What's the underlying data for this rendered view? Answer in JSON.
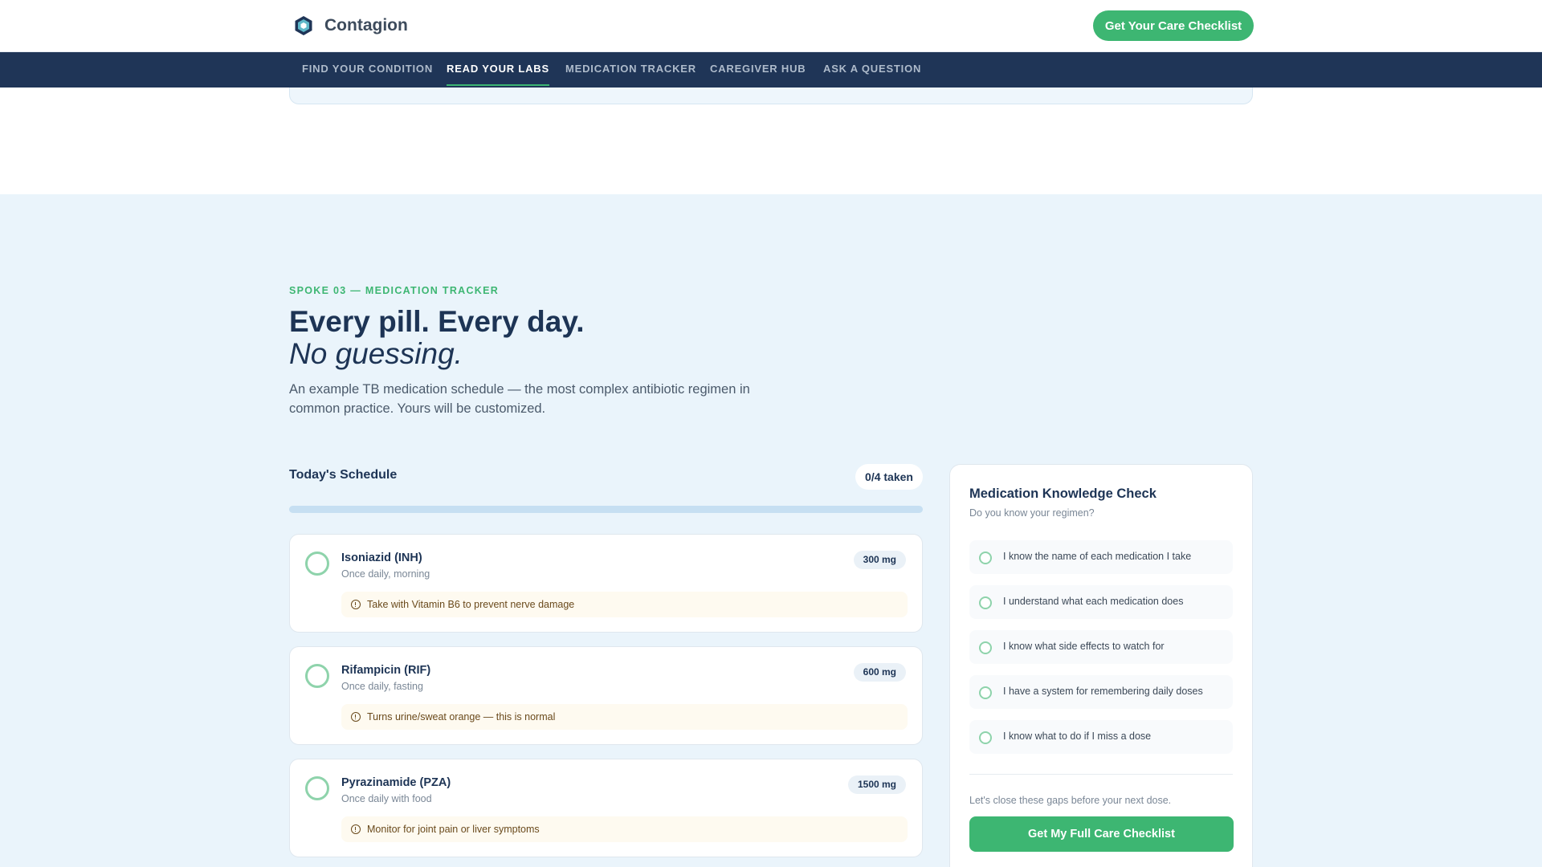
{
  "brand": {
    "name": "Contagion"
  },
  "header": {
    "cta_label": "Get Your Care Checklist"
  },
  "nav": {
    "items": [
      {
        "label": "FIND YOUR CONDITION"
      },
      {
        "label": "READ YOUR LABS",
        "active": true
      },
      {
        "label": "MEDICATION TRACKER"
      },
      {
        "label": "CAREGIVER HUB"
      },
      {
        "label": "ASK A QUESTION"
      }
    ]
  },
  "section": {
    "eyebrow": "SPOKE 03 — MEDICATION TRACKER",
    "title": "Every pill. Every day.",
    "subtitle": "No guessing.",
    "intro": "An example TB medication schedule — the most complex antibiotic regimen in common practice. Yours will be customized."
  },
  "schedule": {
    "title": "Today's Schedule",
    "taken_label": "0/4 taken",
    "progress_fraction": 0,
    "medications": [
      {
        "name": "Isoniazid (INH)",
        "frequency": "Once daily, morning",
        "dose": "300 mg",
        "note": "Take with Vitamin B6 to prevent nerve damage"
      },
      {
        "name": "Rifampicin (RIF)",
        "frequency": "Once daily, fasting",
        "dose": "600 mg",
        "note": "Turns urine/sweat orange — this is normal"
      },
      {
        "name": "Pyrazinamide (PZA)",
        "frequency": "Once daily with food",
        "dose": "1500 mg",
        "note": "Monitor for joint pain or liver symptoms"
      }
    ]
  },
  "knowledge_check": {
    "title": "Medication Knowledge Check",
    "subtitle": "Do you know your regimen?",
    "items": [
      {
        "label": "I know the name of each medication I take"
      },
      {
        "label": "I understand what each medication does"
      },
      {
        "label": "I know what side effects to watch for"
      },
      {
        "label": "I have a system for remembering daily doses"
      },
      {
        "label": "I know what to do if I miss a dose"
      }
    ],
    "note": "Let's close these gaps before your next dose.",
    "cta_label": "Get My Full Care Checklist"
  },
  "colors": {
    "accent_green": "#3db672",
    "navy": "#1f3557",
    "section_bg": "#eaf4fb"
  }
}
